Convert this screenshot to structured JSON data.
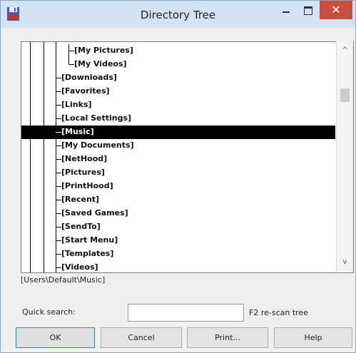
{
  "window": {
    "title": "Directory Tree",
    "close_glyph": "✕"
  },
  "tree": {
    "items": [
      {
        "label": "[My Pictures]",
        "level": 2
      },
      {
        "label": "[My Videos]",
        "level": 2
      },
      {
        "label": "[Downloads]",
        "level": 1
      },
      {
        "label": "[Favorites]",
        "level": 1
      },
      {
        "label": "[Links]",
        "level": 1
      },
      {
        "label": "[Local Settings]",
        "level": 1
      },
      {
        "label": "[Music]",
        "level": 1,
        "selected": true
      },
      {
        "label": "[My Documents]",
        "level": 1
      },
      {
        "label": "[NetHood]",
        "level": 1
      },
      {
        "label": "[Pictures]",
        "level": 1
      },
      {
        "label": "[PrintHood]",
        "level": 1
      },
      {
        "label": "[Recent]",
        "level": 1
      },
      {
        "label": "[Saved Games]",
        "level": 1
      },
      {
        "label": "[SendTo]",
        "level": 1
      },
      {
        "label": "[Start Menu]",
        "level": 1
      },
      {
        "label": "[Templates]",
        "level": 1
      },
      {
        "label": "[Videos]",
        "level": 1
      }
    ]
  },
  "scrollbar": {
    "up_glyph": "^",
    "down_glyph": "v"
  },
  "path": "[Users\\Default\\Music]",
  "quick_search": {
    "label": "Quick search:",
    "value": "",
    "hint": "F2 re-scan tree"
  },
  "buttons": {
    "ok": "OK",
    "cancel": "Cancel",
    "print": "Print...",
    "help": "Help"
  },
  "colors": {
    "title_bar": "#d4e3f2",
    "close": "#c74f3f",
    "selection": "#000000"
  }
}
